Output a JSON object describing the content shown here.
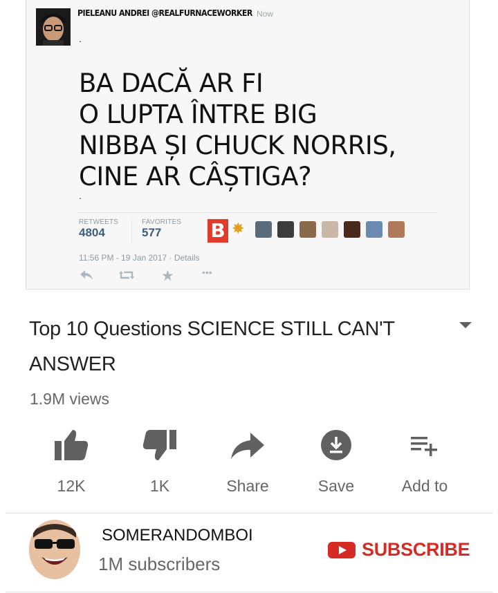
{
  "tweet": {
    "author": "PIELEANU ANDREI @REALFURNACEWORKER",
    "time": "Now",
    "dot_top": ".",
    "text_lines": [
      "BA DACĂ AR FI",
      "O LUPTA ÎNTRE BIG",
      "NIBBA ȘI CHUCK NORRIS,",
      "CINE AR CÂȘTIGA?"
    ],
    "dot_bottom": ".",
    "retweets_label": "RETWEETS",
    "retweets_value": "4804",
    "favorites_label": "FAVORITES",
    "favorites_value": "577",
    "brand_letter": "B",
    "meta": "11:56 PM - 19 Jan 2017 · Details"
  },
  "video": {
    "title": "Top 10 Questions SCIENCE STILL CAN'T ANSWER",
    "views": "1.9M views"
  },
  "actions": {
    "like": "12K",
    "dislike": "1K",
    "share": "Share",
    "save": "Save",
    "add_to": "Add to"
  },
  "channel": {
    "name": "SOMERANDOMBOI",
    "subscribers": "1M subscribers",
    "subscribe_label": "SUBSCRIBE"
  },
  "colors": {
    "accent_red": "#d62b24",
    "stat_blue": "#3b5e80",
    "icon_gray": "#606060"
  }
}
